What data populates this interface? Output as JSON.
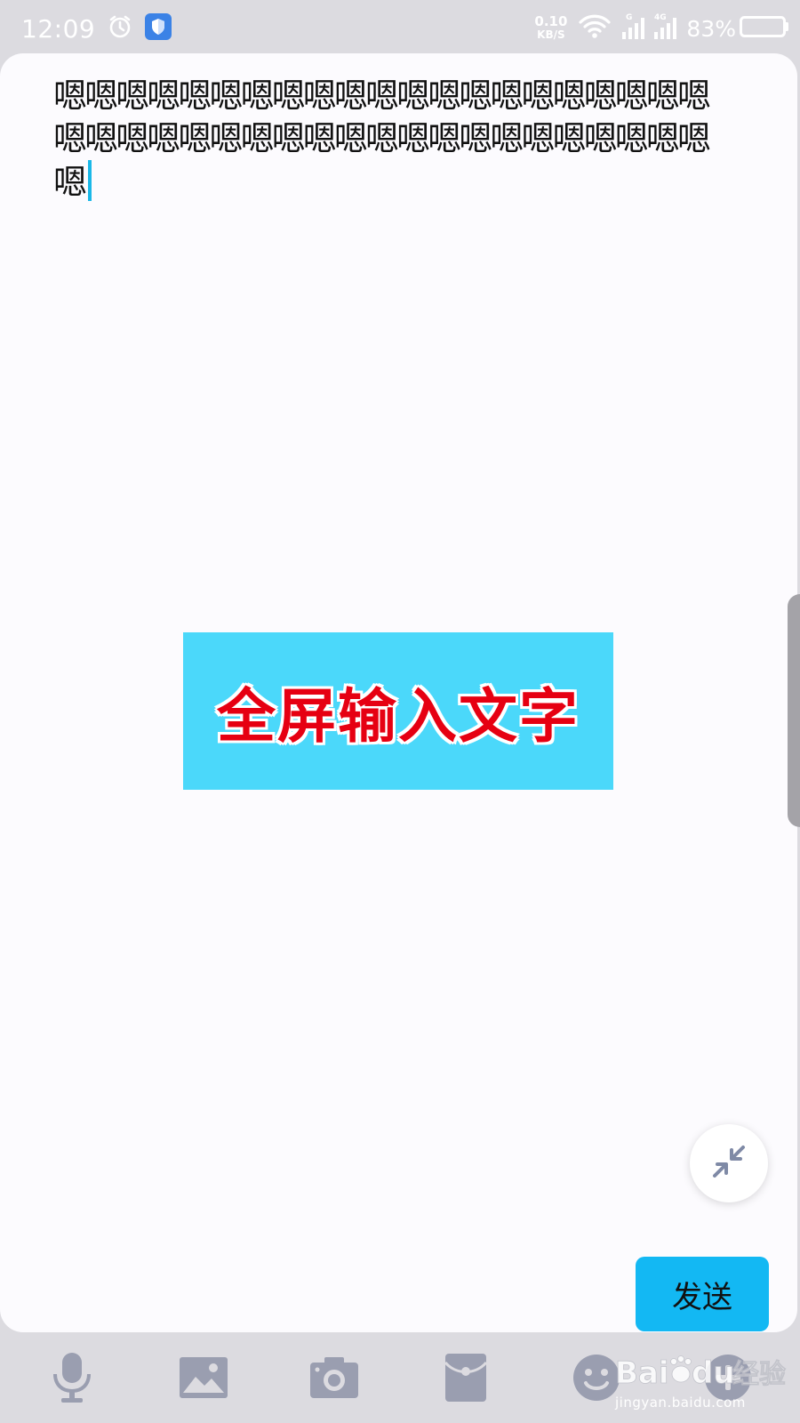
{
  "status_bar": {
    "time": "12:09",
    "net_speed_value": "0.10",
    "net_speed_unit": "KB/S",
    "signal_1_label": "G",
    "signal_2_label": "4G",
    "battery_percent": "83%"
  },
  "input": {
    "text": "嗯嗯嗯嗯嗯嗯嗯嗯嗯嗯嗯嗯嗯嗯嗯嗯嗯嗯嗯嗯嗯嗯嗯嗯嗯嗯嗯嗯嗯嗯嗯嗯嗯嗯嗯嗯嗯嗯嗯嗯嗯嗯嗯"
  },
  "overlay": {
    "banner_text": "全屏输入文字"
  },
  "actions": {
    "send_label": "发送"
  },
  "toolbar": {
    "items": [
      "mic-icon",
      "image-icon",
      "camera-icon",
      "red-packet-icon",
      "emoji-icon",
      "more-icon"
    ]
  },
  "watermark": {
    "brand": "Bai",
    "brand_suffix": "du",
    "product": "经验",
    "url": "jingyan.baidu.com"
  },
  "colors": {
    "accent": "#13b8f3",
    "banner_bg": "#4bd8fa",
    "banner_text": "#e60012",
    "toolbar_icon": "#9a9eb0"
  }
}
